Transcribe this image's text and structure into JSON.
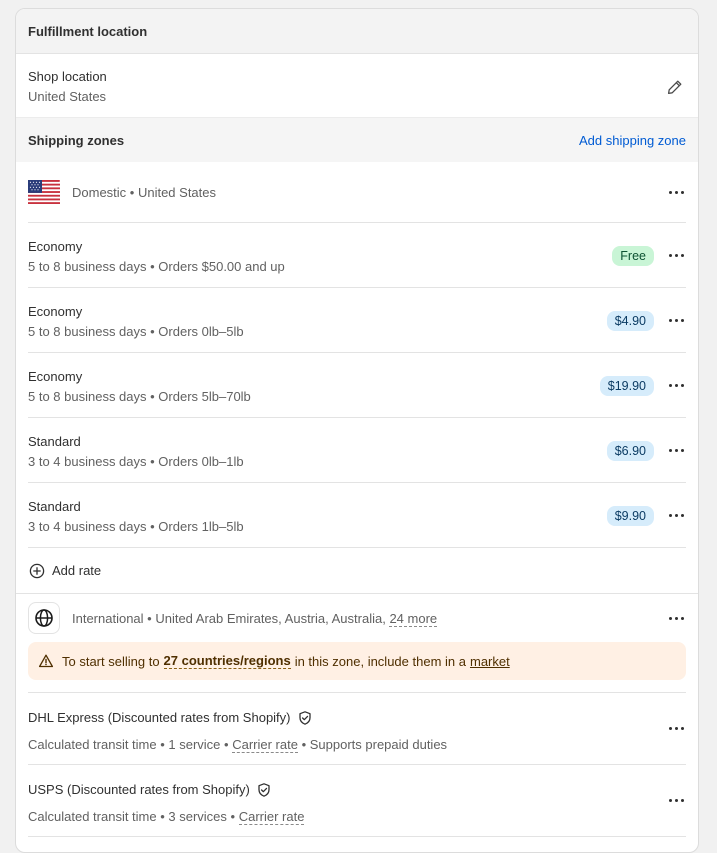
{
  "fulfillment": {
    "title": "Fulfillment location"
  },
  "shop_location": {
    "label": "Shop location",
    "value": "United States"
  },
  "shipping_zones": {
    "title": "Shipping zones",
    "add_zone_label": "Add shipping zone",
    "domestic": {
      "label": "Domestic • United States",
      "rates": [
        {
          "name": "Economy",
          "details": "5 to 8 business days • Orders $50.00 and up",
          "price": "Free"
        },
        {
          "name": "Economy",
          "details": "5 to 8 business days • Orders 0lb–5lb",
          "price": "$4.90"
        },
        {
          "name": "Economy",
          "details": "5 to 8 business days • Orders 5lb–70lb",
          "price": "$19.90"
        },
        {
          "name": "Standard",
          "details": "3 to 4 business days • Orders 0lb–1lb",
          "price": "$6.90"
        },
        {
          "name": "Standard",
          "details": "3 to 4 business days • Orders 1lb–5lb",
          "price": "$9.90"
        }
      ],
      "add_rate_label": "Add rate"
    },
    "international": {
      "label": "International • United Arab Emirates, Austria, Australia,",
      "more_link": "24 more",
      "banner": {
        "prefix": "To start selling to",
        "countries": "27 countries/regions",
        "middle": "in this zone, include them in a",
        "link": "market"
      },
      "carriers": [
        {
          "name": "DHL Express (Discounted rates from Shopify)",
          "d1": "Calculated transit time • 1 service •",
          "d_link": "Carrier rate",
          "d2": "• Supports prepaid duties"
        },
        {
          "name": "USPS (Discounted rates from Shopify)",
          "d1": "Calculated transit time • 3 services •",
          "d_link": "Carrier rate",
          "d2": ""
        }
      ]
    }
  },
  "colors": {
    "accent": "#005bd3",
    "free_badge": "#c9f5d6",
    "price_badge": "#d6ecfb",
    "warning_bg": "#fff0e4"
  },
  "icons": {
    "edit": "pencil-icon",
    "more": "ellipsis-icon",
    "add": "plus-circle-icon",
    "globe": "globe-icon",
    "warning": "warning-icon",
    "verified": "shield-check-icon",
    "flag": "us-flag-icon"
  }
}
